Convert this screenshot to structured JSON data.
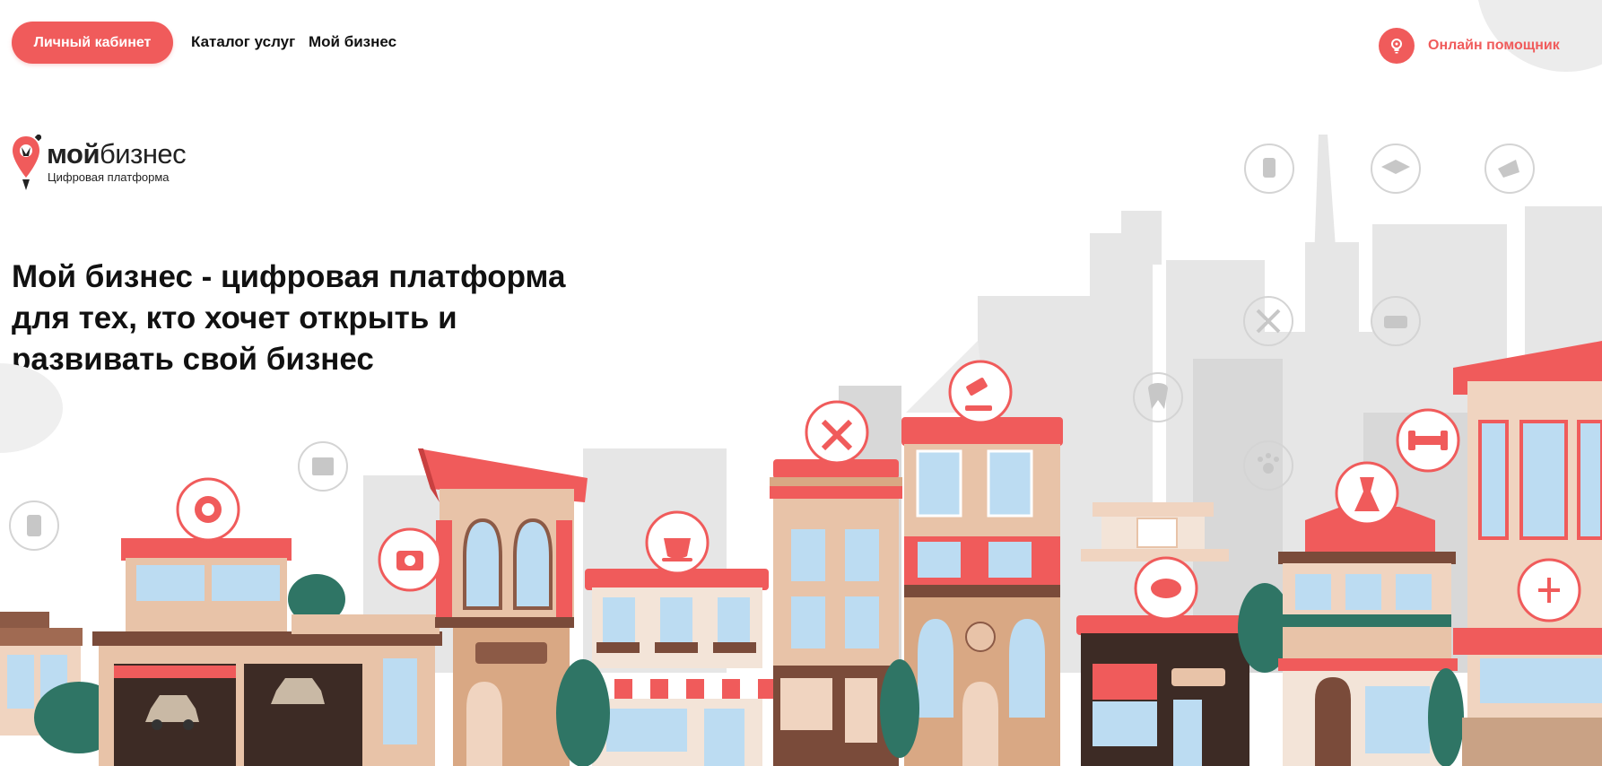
{
  "header": {
    "cabinet_button": "Личный кабинет",
    "nav": [
      {
        "label": "Каталог услуг"
      },
      {
        "label": "Мой бизнес"
      }
    ],
    "assistant_label": "Онлайн помощник",
    "assistant_icon": "lightbulb-icon"
  },
  "logo": {
    "word_bold": "мой",
    "word_regular": "бизнес",
    "subtitle": "Цифровая платформа"
  },
  "hero": {
    "headline_lines": [
      "Мой бизнес - цифровая платформа",
      "для тех, кто хочет открыть и",
      "развивать свой бизнес"
    ]
  },
  "illustration": {
    "icons": [
      "tire-icon",
      "camera-icon",
      "cup-icon",
      "tools-icon",
      "gavel-icon",
      "bread-icon",
      "dress-icon",
      "dumbbell-icon",
      "pharmacy-icon"
    ],
    "faded_icons": [
      "phone-icon",
      "garage-icon",
      "medicine-icon",
      "graduation-cap-icon",
      "ticket-icon",
      "cutlery-icon",
      "basket-icon",
      "tooth-icon",
      "paw-icon"
    ]
  },
  "colors": {
    "accent": "#f05b5b",
    "accent_dark": "#e64545",
    "building_tan": "#e8c3a8",
    "building_brown": "#7a4b3a",
    "glass": "#bcdcf2",
    "tree": "#2f7565",
    "skyline_gray": "#e6e6e6"
  }
}
